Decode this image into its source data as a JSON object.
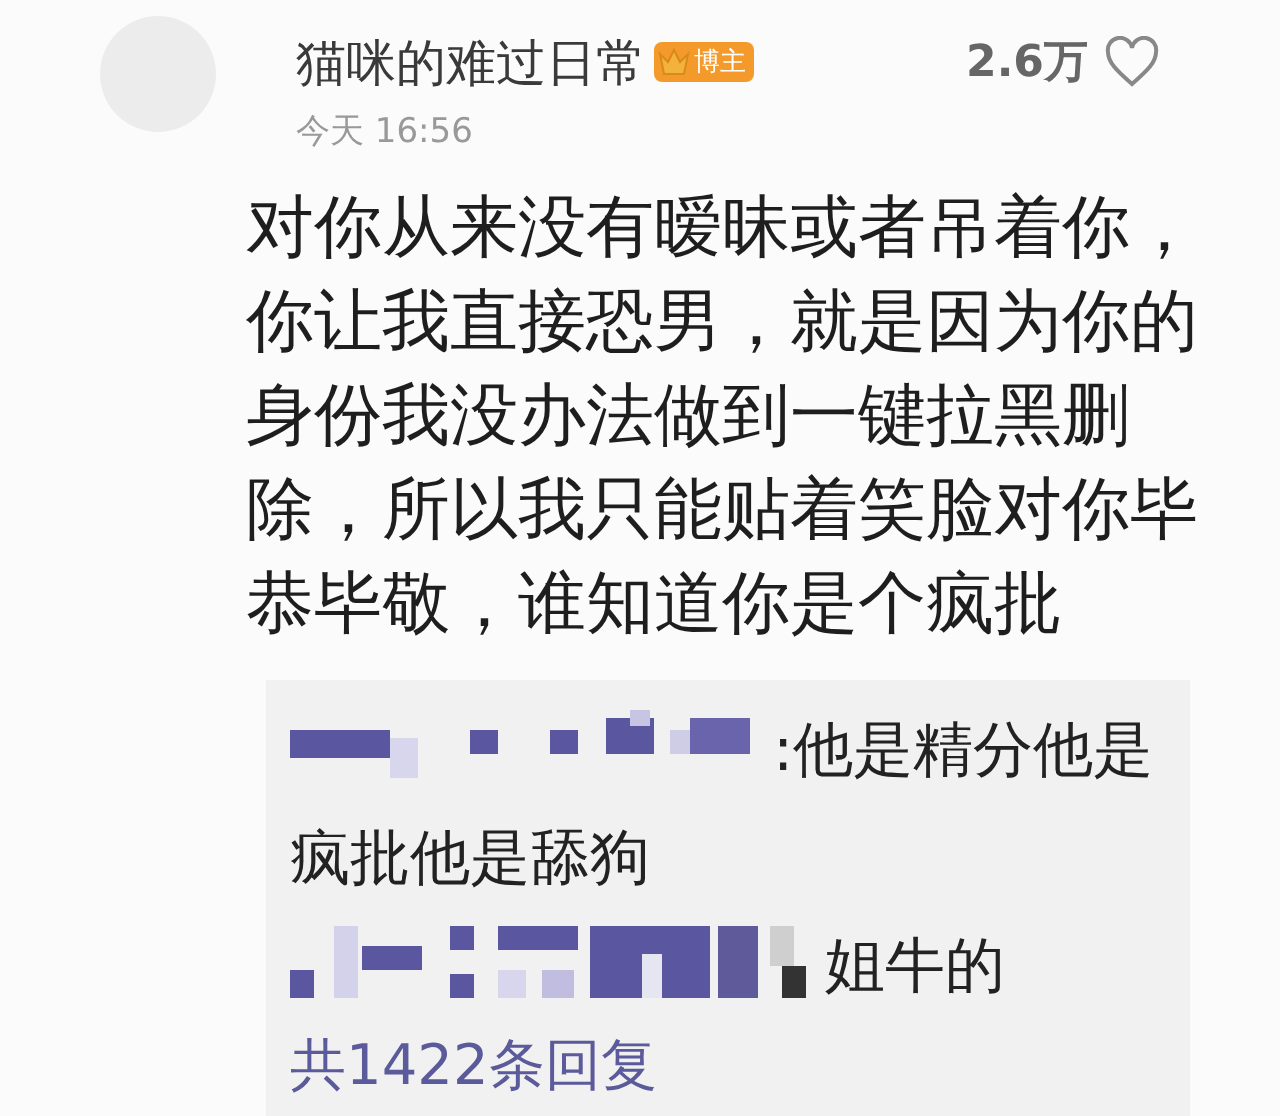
{
  "comment": {
    "author": "猫咪的难过日常",
    "badge": "博主",
    "likes": "2.6万",
    "liked": false,
    "time": "今天 16:56",
    "text": "对你从来没有暧昧或者吊着你，你让我直接恐男，就是因为你的身份我没办法做到一键拉黑删除，所以我只能贴着笑脸对你毕恭毕敬，谁知道你是个疯批"
  },
  "replies": [
    {
      "lines": [
        ":他是精分他是",
        "疯批他是舔狗"
      ]
    },
    {
      "lines": [
        "姐牛的"
      ]
    }
  ],
  "reply_count": "共1422条回复"
}
